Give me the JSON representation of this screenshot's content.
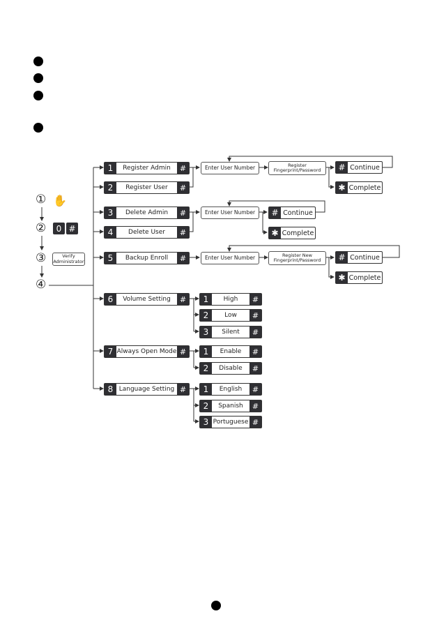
{
  "steps": {
    "step1": "①",
    "step2": "②",
    "step3": "③",
    "step4": "④",
    "hand_icon": "hand-icon",
    "keys": [
      "0",
      "#"
    ],
    "verify": "Verify Administrator"
  },
  "menu": [
    {
      "num": "1",
      "label": "Register Admin"
    },
    {
      "num": "2",
      "label": "Register User"
    },
    {
      "num": "3",
      "label": "Delete Admin"
    },
    {
      "num": "4",
      "label": "Delete User"
    },
    {
      "num": "5",
      "label": "Backup Enroll"
    },
    {
      "num": "6",
      "label": "Volume Setting"
    },
    {
      "num": "7",
      "label": "Always Open Mode"
    },
    {
      "num": "8",
      "label": "Language Setting"
    }
  ],
  "hash": "#",
  "star": "✱",
  "flow": {
    "enter_user_number": "Enter User Number",
    "register_fp": "Register Fingerprint/Password",
    "register_new_fp": "Register New Fingerprint/Password",
    "continue": "Continue",
    "complete": "Complete"
  },
  "volume_options": [
    {
      "num": "1",
      "label": "High"
    },
    {
      "num": "2",
      "label": "Low"
    },
    {
      "num": "3",
      "label": "Silent"
    }
  ],
  "open_mode_options": [
    {
      "num": "1",
      "label": "Enable"
    },
    {
      "num": "2",
      "label": "Disable"
    }
  ],
  "language_options": [
    {
      "num": "1",
      "label": "English"
    },
    {
      "num": "2",
      "label": "Spanish"
    },
    {
      "num": "3",
      "label": "Portuguese"
    }
  ]
}
